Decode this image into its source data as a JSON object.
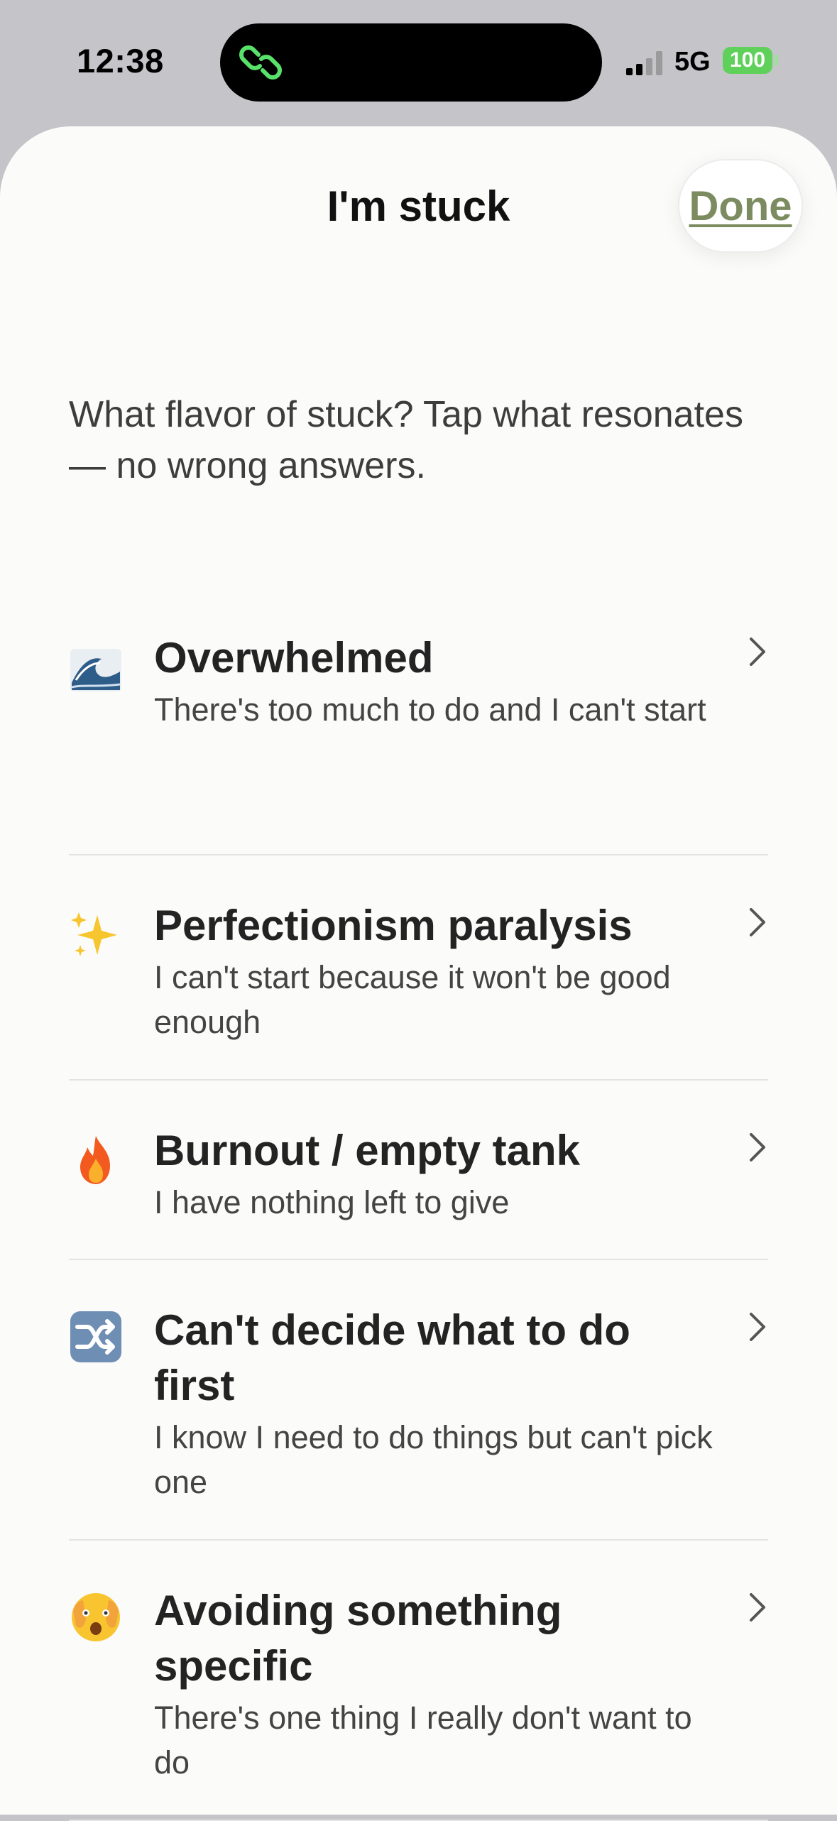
{
  "status_bar": {
    "time": "12:38",
    "network": "5G",
    "battery": "100",
    "signal_icon": "signal-bars-icon",
    "island_icon": "link-icon",
    "battery_color": "#5fd15a"
  },
  "sheet": {
    "title": "I'm stuck",
    "done_label": "Done",
    "accent": "#7c8b60",
    "intro": "What flavor of stuck? Tap what resonates — no wrong answers."
  },
  "options": [
    {
      "icon": "wave-emoji-icon",
      "title": "Overwhelmed",
      "description": "There's too much to do and I can't start"
    },
    {
      "icon": "sparkles-emoji-icon",
      "title": "Perfectionism paralysis",
      "description": "I can't start because it won't be good enough"
    },
    {
      "icon": "fire-emoji-icon",
      "title": "Burnout / empty tank",
      "description": "I have nothing left to give"
    },
    {
      "icon": "shuffle-emoji-icon",
      "title": "Can't decide what to do first",
      "description": "I know I need to do things but can't pick one"
    },
    {
      "icon": "face-peeking-emoji-icon",
      "title": "Avoiding something specific",
      "description": "There's one thing I really don't want to do"
    }
  ]
}
